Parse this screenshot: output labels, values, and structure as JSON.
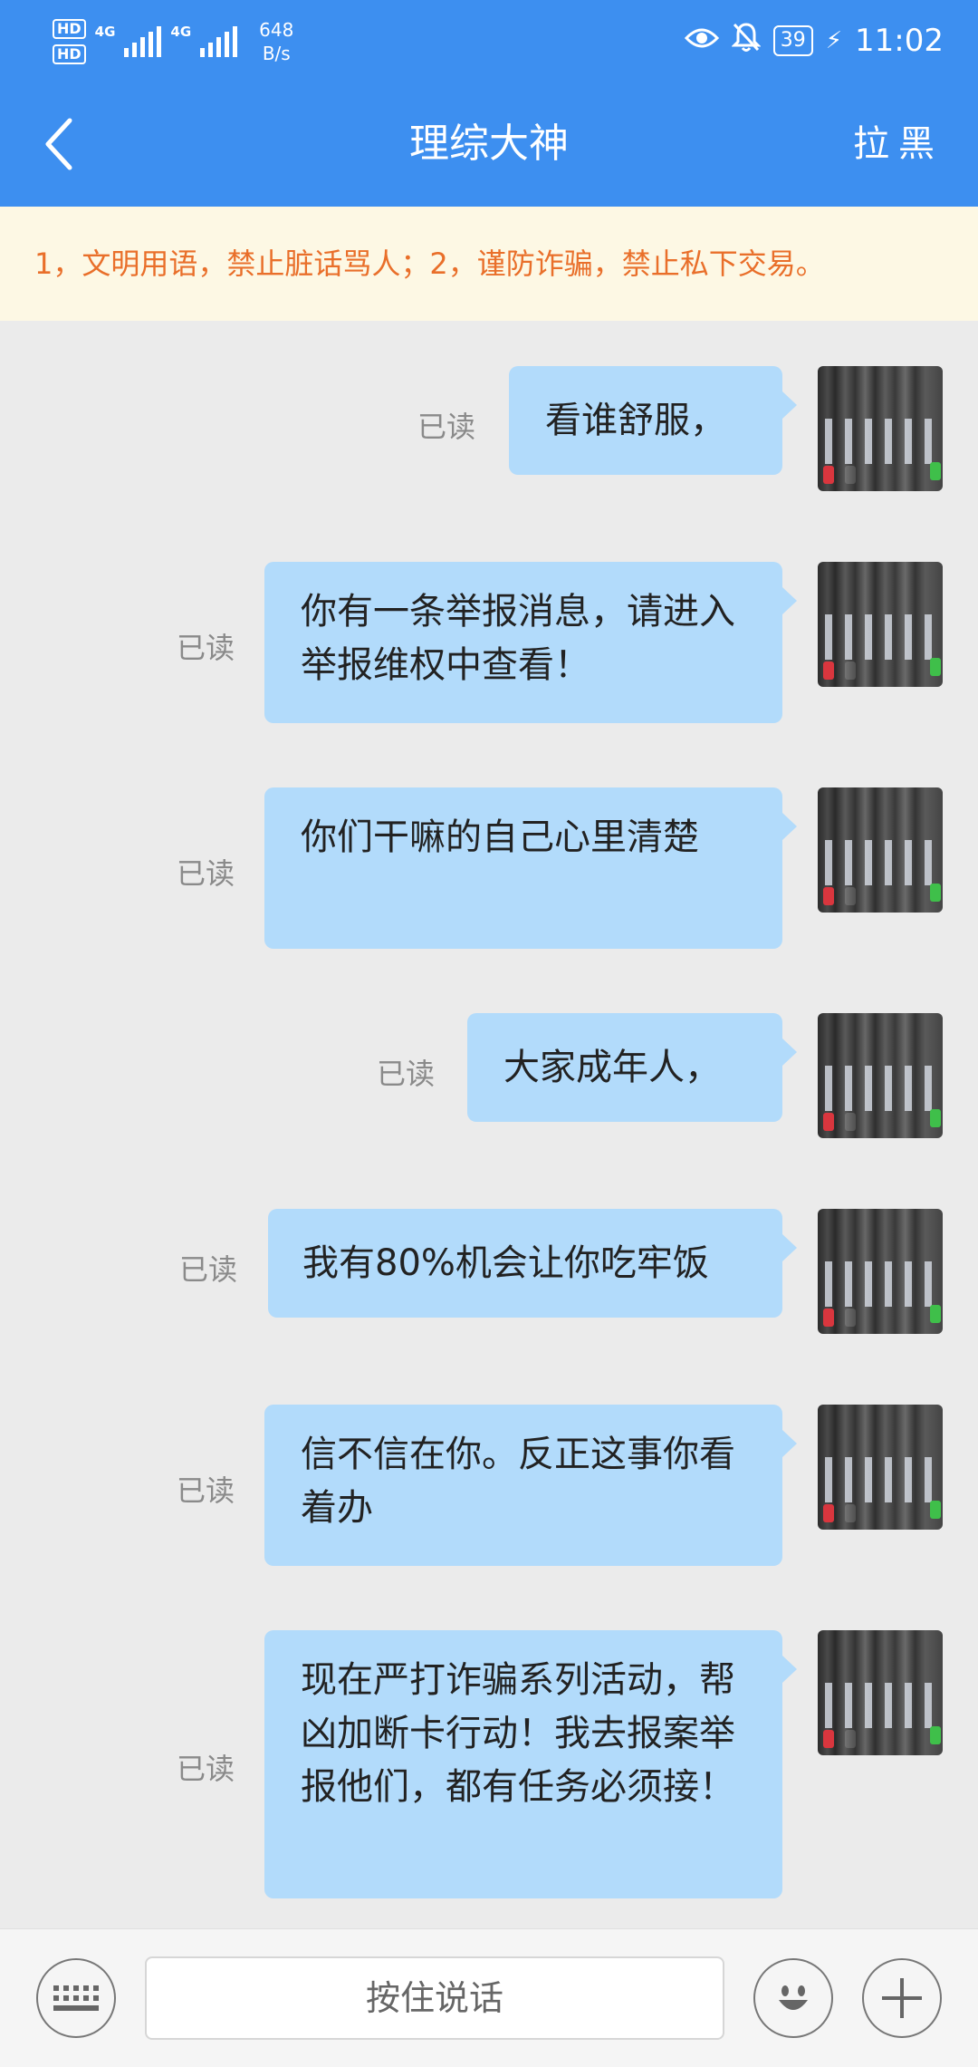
{
  "status_bar": {
    "hd1": "HD",
    "hd2": "HD",
    "net1": "4G",
    "net2": "4G",
    "speed_value": "648",
    "speed_unit": "B/s",
    "battery": "39",
    "time": "11:02"
  },
  "header": {
    "title": "理综大神",
    "block_label": "拉黑"
  },
  "notice": "1，文明用语，禁止脏话骂人；2，谨防诈骗，禁止私下交易。",
  "messages": [
    {
      "read": "已读",
      "text": "看谁舒服，"
    },
    {
      "read": "已读",
      "text": "你有一条举报消息，请进入举报维权中查看！"
    },
    {
      "read": "已读",
      "text": "你们干嘛的自己心里清楚"
    },
    {
      "read": "已读",
      "text": "大家成年人，"
    },
    {
      "read": "已读",
      "text": "我有80%机会让你吃牢饭"
    },
    {
      "read": "已读",
      "text": "信不信在你。反正这事你看着办"
    },
    {
      "read": "已读",
      "text": "现在严打诈骗系列活动，帮凶加断卡行动！我去报案举报他们，都有任务必须接！"
    }
  ],
  "input_bar": {
    "hold_to_talk": "按住说话",
    "icons": [
      "keyboard-icon",
      "emoji-icon",
      "plus-icon"
    ]
  },
  "colors": {
    "header_blue": "#3d8ff0",
    "bubble_blue": "#b2dbfb",
    "notice_bg": "#fdf8e4",
    "notice_text": "#e96f2a"
  }
}
